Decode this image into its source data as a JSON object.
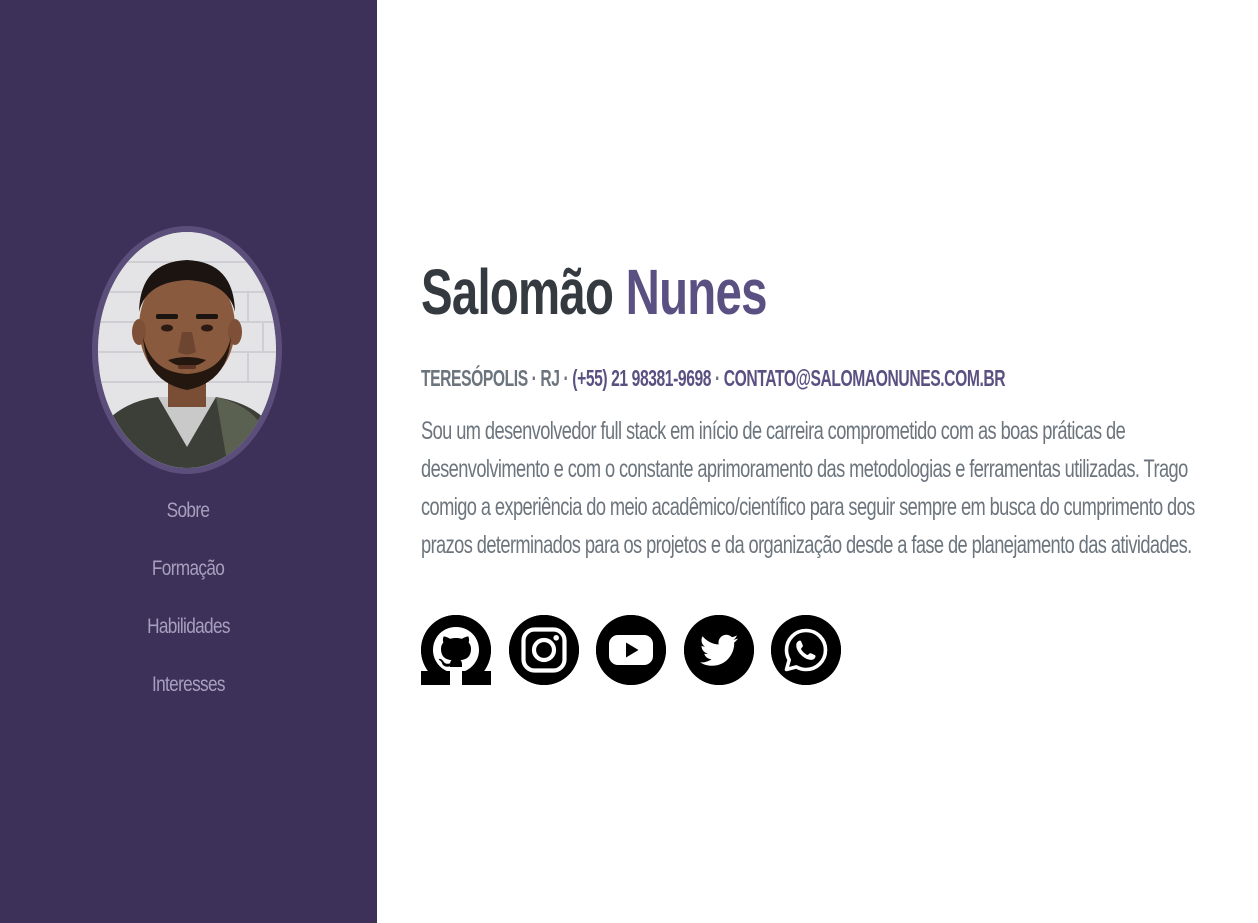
{
  "profile": {
    "photo_alt": "Foto de Salomão Nunes"
  },
  "nav": {
    "items": [
      {
        "label": "Sobre"
      },
      {
        "label": "Formação"
      },
      {
        "label": "Habilidades"
      },
      {
        "label": "Interesses"
      }
    ]
  },
  "about": {
    "first_name": "Salomão",
    "last_name": "Nunes",
    "location": "Teresópolis · RJ ·",
    "phone": "(+55) 21 98381-9698",
    "separator": "·",
    "email": "contato@salomaonunes.com.br",
    "description": "Sou um desenvolvedor full stack em início de carreira comprometido com as boas práticas de desenvolvimento e com o constante aprimoramento das metodologias e ferramentas utilizadas. Trago comigo a experiência do meio acadêmico/científico para seguir sempre em busca do cumprimento dos prazos determinados para os projetos e da organização desde a fase de planejamento das atividades."
  },
  "social": {
    "icons": [
      "github-icon",
      "instagram-icon",
      "youtube-icon",
      "twitter-icon",
      "whatsapp-icon"
    ]
  },
  "colors": {
    "sidebar_bg": "#3d3159",
    "accent": "#5a5082",
    "text_dark": "#343a40",
    "text_muted": "#6c757d",
    "nav_text": "#a89fbd"
  }
}
